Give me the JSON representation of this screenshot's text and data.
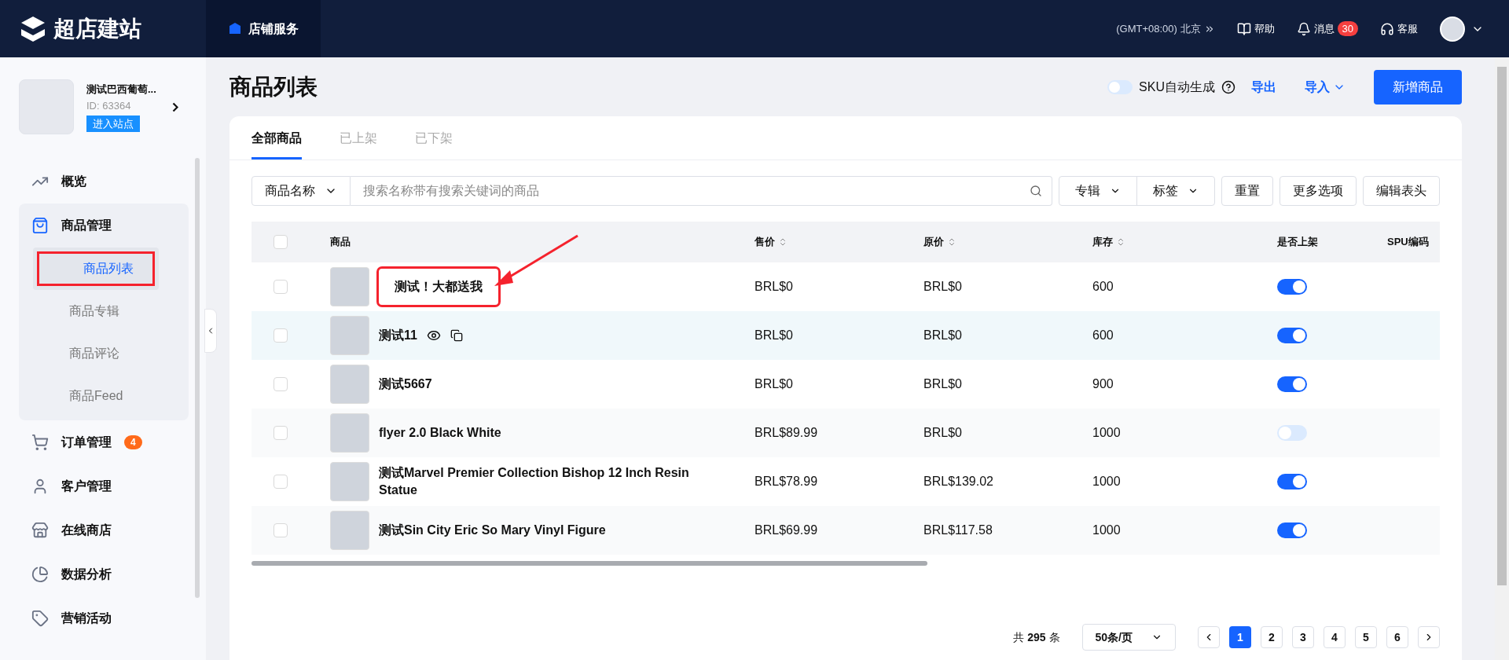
{
  "topbar": {
    "logo": "超店建站",
    "nav": [
      {
        "label": "店铺服务",
        "selected": true
      }
    ],
    "timezone": "(GMT+08:00) 北京",
    "help": "帮助",
    "messages": "消息",
    "message_count": "30",
    "service": "客服"
  },
  "sidebar": {
    "store": {
      "name": "测试巴西葡萄...",
      "id": "ID: 63364",
      "enter": "进入站点"
    },
    "items": [
      {
        "label": "概览",
        "expanded": false
      },
      {
        "label": "商品管理",
        "expanded": true,
        "children": [
          {
            "label": "商品列表",
            "selected": true,
            "highlighted": true
          },
          {
            "label": "商品专辑",
            "selected": false,
            "highlighted": false
          },
          {
            "label": "商品评论",
            "selected": false,
            "highlighted": false
          },
          {
            "label": "商品Feed",
            "selected": false,
            "highlighted": false
          }
        ]
      },
      {
        "label": "订单管理",
        "badge": "4",
        "expanded": false
      },
      {
        "label": "客户管理",
        "expanded": false
      },
      {
        "label": "在线商店",
        "expanded": false
      },
      {
        "label": "数据分析",
        "expanded": false
      },
      {
        "label": "营销活动",
        "expanded": false
      }
    ]
  },
  "header": {
    "title": "商品列表",
    "sku_toggle": {
      "label": "SKU自动生成",
      "on": false
    },
    "export": "导出",
    "import": "导入",
    "add": "新增商品"
  },
  "tabs": [
    {
      "label": "全部商品",
      "selected": true
    },
    {
      "label": "已上架",
      "selected": false
    },
    {
      "label": "已下架",
      "selected": false
    }
  ],
  "filters": {
    "field": "商品名称",
    "search": {
      "placeholder": "搜索名称带有搜索关键词的商品"
    },
    "dropdowns": [
      "专辑",
      "标签"
    ],
    "buttons": [
      "重置",
      "更多选项",
      "编辑表头"
    ]
  },
  "table": {
    "all_checked": false,
    "columns": [
      {
        "label": "商品",
        "sortable": false
      },
      {
        "label": "售价",
        "sortable": true
      },
      {
        "label": "原价",
        "sortable": true
      },
      {
        "label": "库存",
        "sortable": true
      },
      {
        "label": "是否上架",
        "sortable": false
      },
      {
        "label": "SPU编码",
        "sortable": false
      }
    ],
    "rows": [
      {
        "name": "测试！大都送我",
        "price": "BRL$0",
        "original": "BRL$0",
        "stock": "600",
        "on": true,
        "hovered": false,
        "highlighted": true
      },
      {
        "name": "测试11",
        "price": "BRL$0",
        "original": "BRL$0",
        "stock": "600",
        "on": true,
        "hovered": true,
        "highlighted": false
      },
      {
        "name": "测试5667",
        "price": "BRL$0",
        "original": "BRL$0",
        "stock": "900",
        "on": true,
        "hovered": false,
        "highlighted": false
      },
      {
        "name": "flyer 2.0 Black White",
        "price": "BRL$89.99",
        "original": "BRL$0",
        "stock": "1000",
        "on": false,
        "hovered": false,
        "highlighted": false
      },
      {
        "name": "测试Marvel Premier Collection Bishop 12 Inch Resin Statue",
        "price": "BRL$78.99",
        "original": "BRL$139.02",
        "stock": "1000",
        "on": true,
        "hovered": false,
        "highlighted": false
      },
      {
        "name": "测试Sin City Eric So Mary Vinyl Figure",
        "price": "BRL$69.99",
        "original": "BRL$117.58",
        "stock": "1000",
        "on": true,
        "hovered": false,
        "highlighted": false
      }
    ]
  },
  "pagination": {
    "total": "共 **295** 条",
    "page_size": "50条/页",
    "pages": [
      {
        "label": "1",
        "selected": true
      },
      {
        "label": "2",
        "selected": false
      },
      {
        "label": "3",
        "selected": false
      },
      {
        "label": "4",
        "selected": false
      },
      {
        "label": "5",
        "selected": false
      },
      {
        "label": "6",
        "selected": false
      }
    ]
  }
}
